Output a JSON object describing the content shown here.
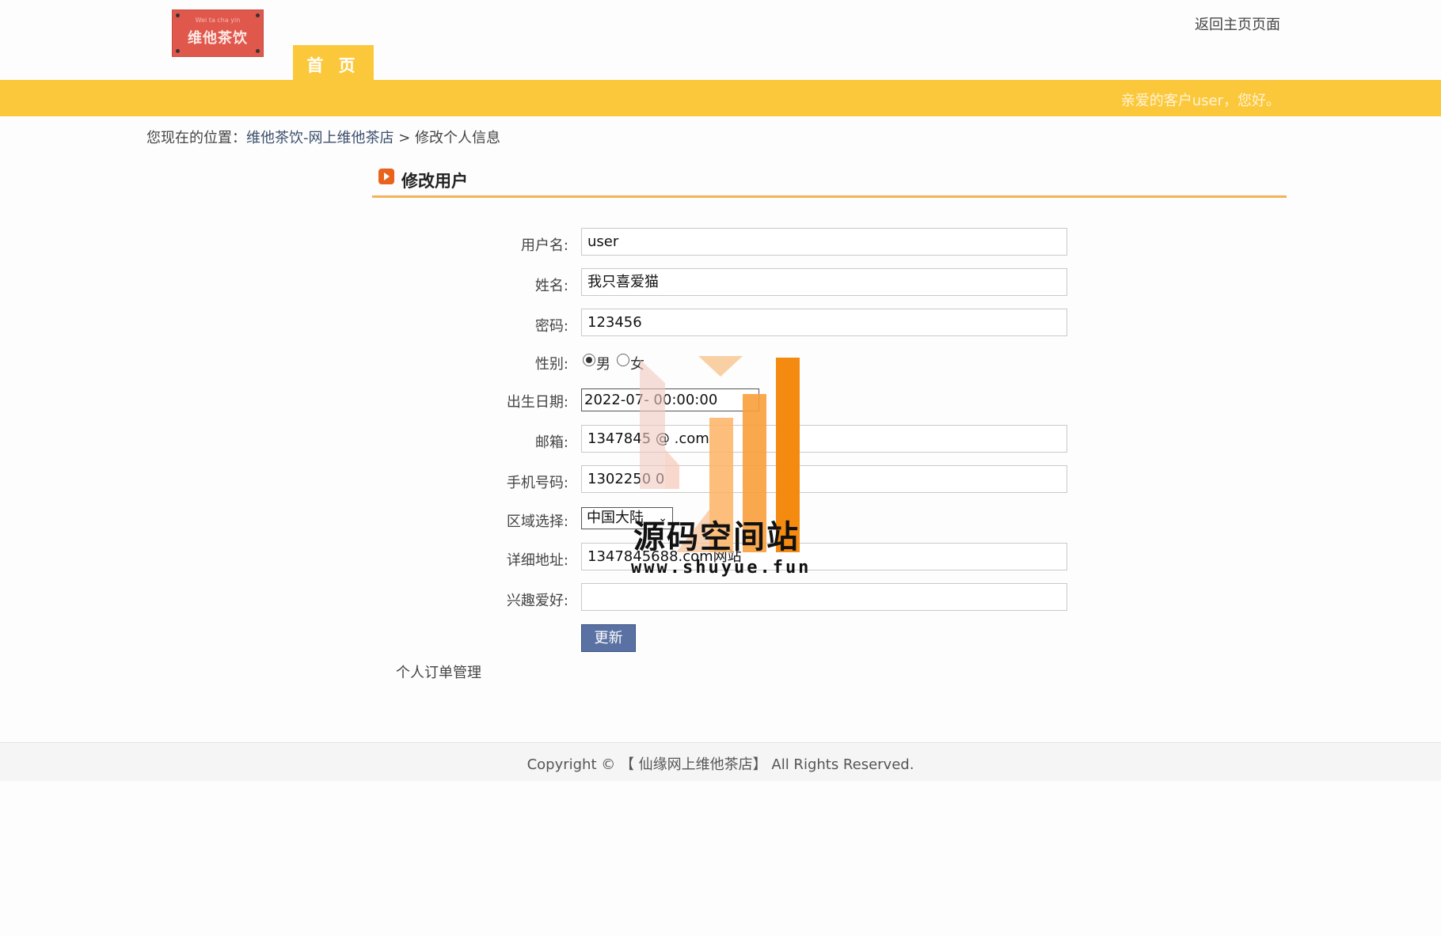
{
  "logo": {
    "subtext": "Wei ta cha yin",
    "text": "维他茶饮"
  },
  "nav": {
    "home_tab": "首 页",
    "return_link": "返回主页页面"
  },
  "greeting": "亲爱的客户user，您好。",
  "breadcrumb": {
    "prefix": "您现在的位置：",
    "site": "维他茶饮-网上维他茶店",
    "separator": " > ",
    "current": "修改个人信息"
  },
  "section": {
    "title": "修改用户"
  },
  "form": {
    "username_label": "用户名:",
    "username_value": "user",
    "name_label": "姓名:",
    "name_value": "我只喜爱猫",
    "password_label": "密码:",
    "password_value": "123456",
    "gender_label": "性别:",
    "gender_male": "男",
    "gender_female": "女",
    "birth_label": "出生日期:",
    "birth_value": "2022-07-   00:00:00",
    "email_label": "邮箱:",
    "email_value": "1347845   @   .com",
    "phone_label": "手机号码:",
    "phone_value": "1302250   0",
    "region_label": "区域选择:",
    "region_value": "中国大陆",
    "address_label": "详细地址:",
    "address_value": "1347845688.com网站",
    "hobby_label": "兴趣爱好:",
    "hobby_value": "",
    "update_button": "更新"
  },
  "order_link": "个人订单管理",
  "watermark": {
    "title": "源码空间站",
    "url": "www.shuyue.fun"
  },
  "footer": {
    "text": "Copyright © 【 仙缘网上维他茶店】 All Rights Reserved."
  },
  "colors": {
    "accent_yellow": "#fcc83b",
    "logo_red": "#e0584c",
    "button_blue": "#5a71a3",
    "rule_orange": "#f0b35a"
  }
}
